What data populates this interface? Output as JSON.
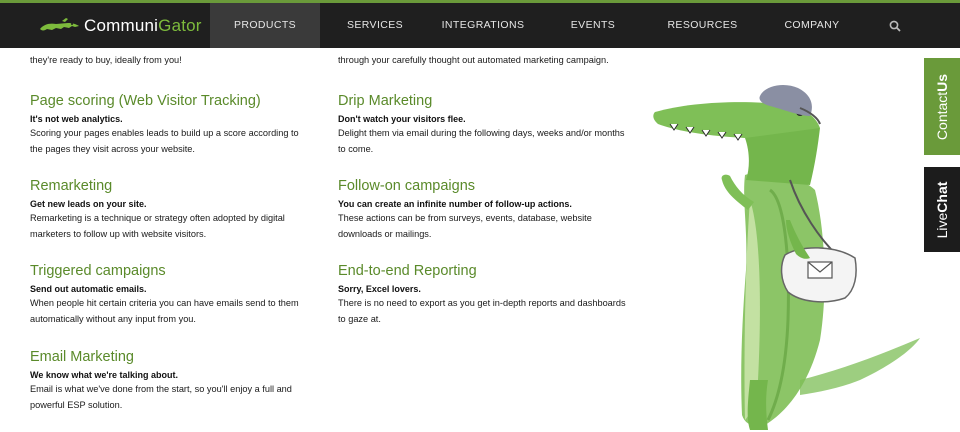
{
  "brand": {
    "name_part1": "Communi",
    "name_part2": "Gator"
  },
  "nav": {
    "items": [
      {
        "label": "PRODUCTS",
        "active": true
      },
      {
        "label": "SERVICES"
      },
      {
        "label": "INTEGRATIONS"
      },
      {
        "label": "EVENTS"
      },
      {
        "label": "RESOURCES"
      },
      {
        "label": "COMPANY"
      }
    ],
    "search_icon": "search-icon"
  },
  "partial_top": {
    "left_line": "they're ready to buy, ideally from you!",
    "right_line": "through your carefully thought out automated marketing campaign."
  },
  "features": [
    {
      "title": "Page scoring (Web Visitor Tracking)",
      "lead": "It's not web analytics.",
      "desc1": "Scoring your pages enables leads to build up a score according to",
      "desc2": "the pages they visit across your website."
    },
    {
      "title": "Drip Marketing",
      "lead": "Don't watch your visitors flee.",
      "desc1": "Delight them via email during the following days, weeks and/or months",
      "desc2": "to come."
    },
    {
      "title": "Remarketing",
      "lead": "Get new leads on your site.",
      "desc1": "Remarketing is a technique or strategy often adopted by digital",
      "desc2": "marketers to follow up with website visitors."
    },
    {
      "title": "Follow-on campaigns",
      "lead": "You can create an infinite number of follow-up actions.",
      "desc1": "These actions can be from surveys, events, database, website",
      "desc2": "downloads or mailings."
    },
    {
      "title": "Triggered campaigns",
      "lead": "Send out automatic emails.",
      "desc1": "When people hit certain criteria you can have emails send to them",
      "desc2": "automatically without any input from you."
    },
    {
      "title": "End-to-end Reporting",
      "lead": "Sorry, Excel lovers.",
      "desc1": "There is no need to export as you get in-depth reports and dashboards",
      "desc2": "to gaze at."
    },
    {
      "title": "Email Marketing",
      "lead": "We know what we're talking about.",
      "desc1": "Email is what we've done from the start, so you'll enjoy a full and",
      "desc2": "powerful ESP solution."
    }
  ],
  "side_tabs": {
    "contact_part1": "Contact",
    "contact_part2": "Us",
    "livechat_part1": "Live",
    "livechat_part2": "Chat"
  },
  "colors": {
    "accent": "#6a9a3a",
    "nav_bg": "#1f1f1f",
    "heading_green": "#5a8a2a"
  },
  "mascot": "alligator-mailman-illustration"
}
